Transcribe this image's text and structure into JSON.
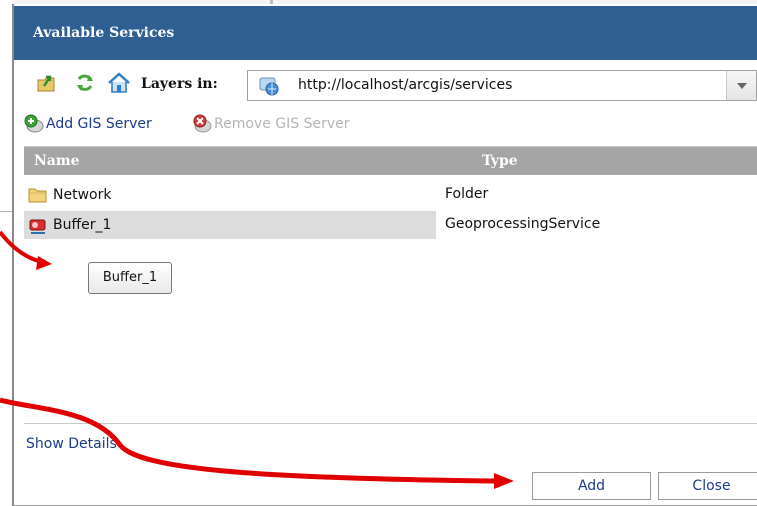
{
  "dialog": {
    "title": "Available Services",
    "layers_label": "Layers in:",
    "url": "http://localhost/arcgis/services",
    "add_server_label": "Add GIS Server",
    "remove_server_label": "Remove GIS Server"
  },
  "grid": {
    "columns": [
      "Name",
      "Type"
    ],
    "rows": [
      {
        "name": "Network",
        "type": "Folder",
        "icon": "folder-icon",
        "selected": false
      },
      {
        "name": "Buffer_1",
        "type": "GeoprocessingService",
        "icon": "geoprocessing-service-icon",
        "selected": true
      }
    ]
  },
  "tooltip": {
    "text": "Buffer_1"
  },
  "footer": {
    "show_details": "Show Details",
    "add_label": "Add",
    "close_label": "Close"
  },
  "annotations": {
    "arrow_color": "#e00000"
  },
  "colors": {
    "title_bar": "#2f5f93",
    "header": "#a5a5a5",
    "selected_row": "#dcdcdc",
    "link": "#1b3a8a"
  }
}
